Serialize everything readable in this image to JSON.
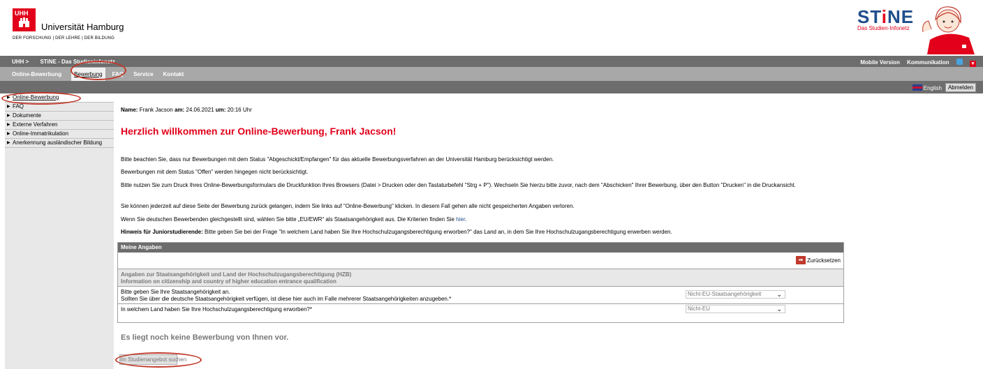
{
  "header": {
    "uhh_box": "UHH",
    "uni_name": "Universität Hamburg",
    "uni_tagline": "DER FORSCHUNG | DER LEHRE | DER BILDUNG",
    "stine_title_a": "ST",
    "stine_title_i": "i",
    "stine_title_b": "NE",
    "stine_subtitle": "Das Studien-Infonetz"
  },
  "topbar": {
    "crumb_uhh": "UHH >",
    "crumb_stine": "STiNE - Das Studieninfonetz",
    "mobile": "Mobile Version",
    "comm": "Kommunikation"
  },
  "nav": {
    "items": [
      {
        "label": "Online-Bewerbung"
      },
      {
        "label": "Bewerbung"
      },
      {
        "label": "FAQ"
      },
      {
        "label": "Service"
      },
      {
        "label": "Kontakt"
      }
    ]
  },
  "util": {
    "lang": "English",
    "logout": "Abmelden"
  },
  "sidebar": {
    "items": [
      {
        "label": "Online-Bewerbung"
      },
      {
        "label": "FAQ"
      },
      {
        "label": "Dokumente"
      },
      {
        "label": "Externe Verfahren"
      },
      {
        "label": "Online-Immatrikulation"
      },
      {
        "label": "Anerkennung ausländischer Bildung"
      }
    ]
  },
  "main": {
    "name_label": "Name:",
    "name_value": "Frank Jacson",
    "am_label": "am:",
    "date": "24.06.2021",
    "um_label": "um:",
    "time": "20:16 Uhr",
    "welcome": "Herzlich willkommen zur Online-Bewerbung, Frank Jacson!",
    "p1": "Bitte beachten Sie, dass nur Bewerbungen mit dem Status \"Abgeschickt/Empfangen\" für das aktuelle Bewerbungsverfahren an der Universität Hamburg berücksichtigt werden.",
    "p2": "Bewerbungen mit dem Status \"Offen\" werden hingegen nicht berücksichtigt.",
    "p3": "Bitte nutzen Sie zum Druck Ihres Online-Bewerbungsformulars die Druckfunktion Ihres Browsers (Datei > Drucken oder den Tastaturbefehl \"Strg + P\"). Wechseln Sie hierzu bitte zuvor, nach dem \"Abschicken\" Ihrer Bewerbung, über den Button \"Drucken\" in die Druckansicht.",
    "p4": "Sie können jederzeit auf diese Seite der Bewerbung zurück gelangen, indem Sie links auf \"Online-Bewerbung\" klicken. In diesem Fall gehen alle nicht gespeicherten Angaben verloren.",
    "p5_pre": "Wenn Sie deutschen Bewerbenden gleichgestellt sind, wählen Sie bitte „EU/EWR“ als Staatsangehörigkeit aus. Die Kriterien finden Sie",
    "p5_link": "hier",
    "p6_label": "Hinweis für Juniorstudierende:",
    "p6_text": "Bitte geben Sie bei der Frage \"In welchem Land haben Sie Ihre Hochschulzugangsberechtigung erworben?\" das Land an, in dem Sie Ihre Hochschulzugangsberechtigung erwerben werden."
  },
  "form": {
    "heading": "Meine Angaben",
    "reset": "Zurücksetzen",
    "section_de": "Angaben zur Staatsangehörigkeit und Land der Hochschulzugangsberechtigung (HZB)",
    "section_en": "Information on citizenship and country of higher education entrance qualification",
    "q1_line1": "Bitte geben Sie Ihre Staatsangehörigkeit an.",
    "q1_line2": "Sollten Sie über die deutsche Staatsangehörigkeit verfügen, ist diese hier auch im Falle mehrerer Staatsangehörigkeiten anzugeben.*",
    "q1_value": "Nicht-EU-Staatsangehörigkeit",
    "q2": "In welchem Land haben Sie Ihre Hochschulzugangsberechtigung erworben?*",
    "q2_value": "Nicht-EU"
  },
  "footer": {
    "no_application": "Es liegt noch keine Bewerbung von Ihnen vor.",
    "search_button": "Im Studienangebot suchen"
  },
  "colors": {
    "brand_red": "#e2001a",
    "stine_blue": "#1f4e8c",
    "bar_dark": "#6d6d6d",
    "bar_light": "#a8a8a8"
  }
}
